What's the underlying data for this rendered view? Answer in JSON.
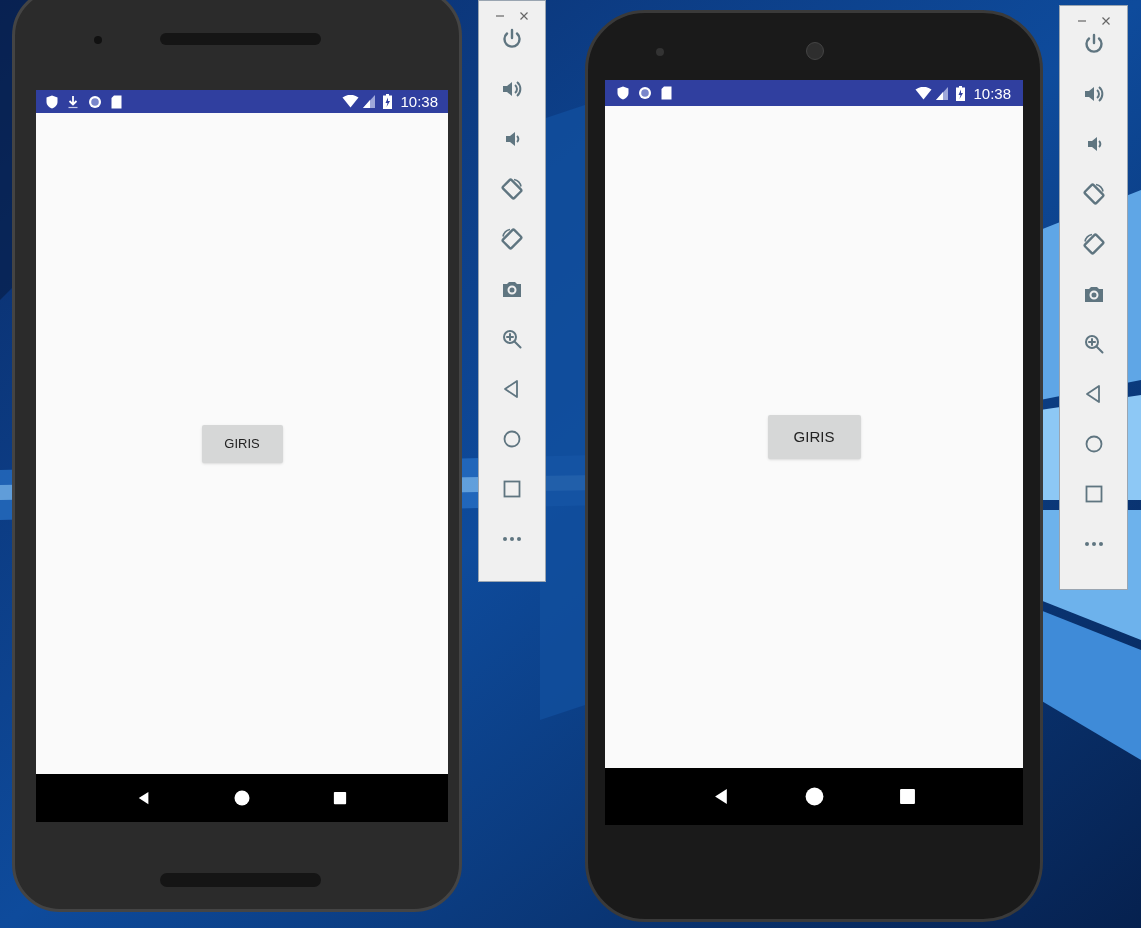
{
  "emulators": [
    {
      "status_bar": {
        "time": "10:38"
      },
      "button": "GIRIS"
    },
    {
      "status_bar": {
        "time": "10:38"
      },
      "button": "GIRIS"
    }
  ]
}
